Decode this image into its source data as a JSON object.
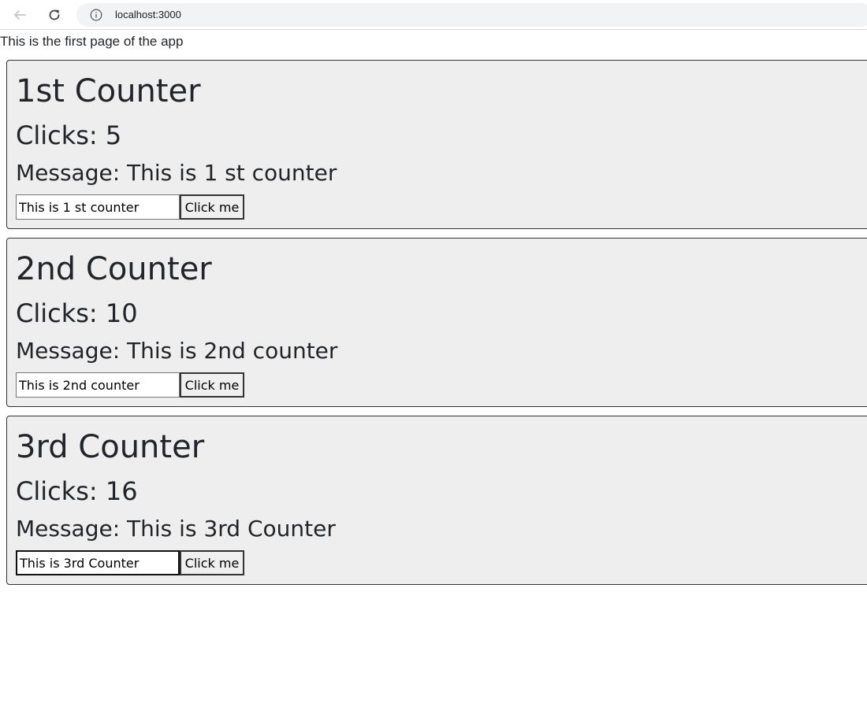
{
  "browser": {
    "url": "localhost:3000",
    "icons": [
      "back-arrow-icon",
      "reload-icon",
      "info-icon"
    ]
  },
  "page": {
    "intro": "This is the first page of the app"
  },
  "counters": [
    {
      "title": "1st Counter",
      "clicks": "Clicks: 5",
      "message": "Message: This is 1 st counter",
      "input_value": "This is 1 st counter",
      "button_label": "Click me"
    },
    {
      "title": "2nd Counter",
      "clicks": "Clicks: 10",
      "message": "Message: This is 2nd counter",
      "input_value": "This is 2nd counter",
      "button_label": "Click me"
    },
    {
      "title": "3rd Counter",
      "clicks": "Clicks: 16",
      "message": "Message: This is 3rd Counter",
      "input_value": "This is 3rd Counter",
      "button_label": "Click me"
    }
  ],
  "colors": {
    "card_background": "#eeeeee",
    "card_border": "#333333",
    "text": "#212529"
  }
}
